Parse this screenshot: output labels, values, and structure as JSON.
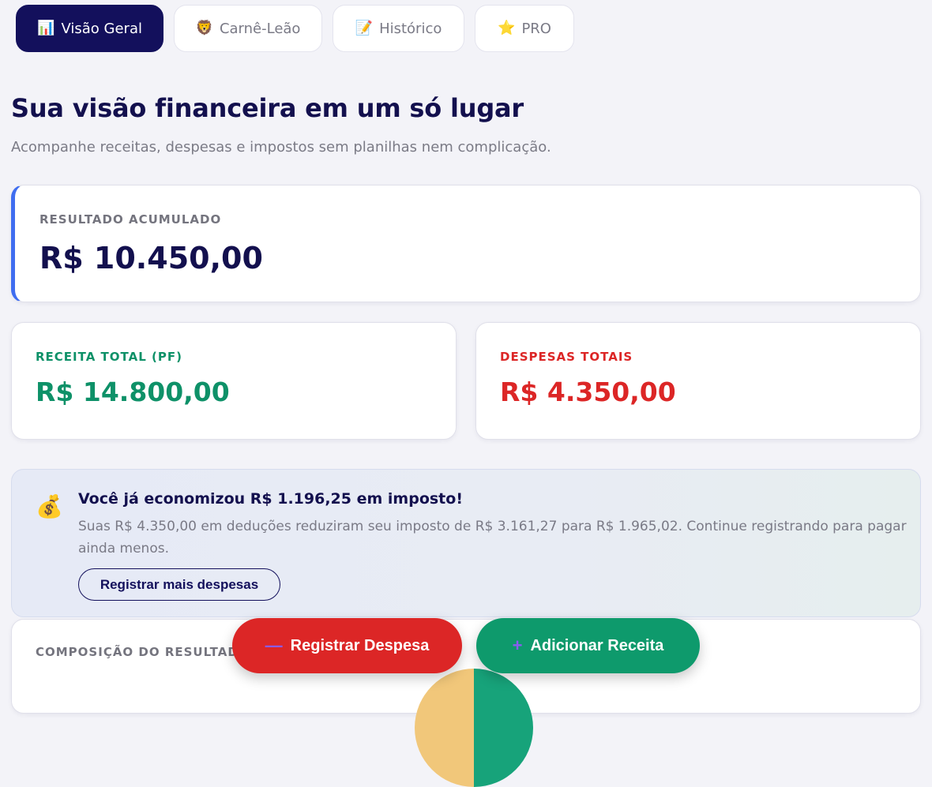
{
  "tabs": [
    {
      "icon": "bar-chart-icon",
      "glyph": "📊",
      "label": "Visão Geral",
      "active": true
    },
    {
      "icon": "lion-icon",
      "glyph": "🦁",
      "label": "Carnê-Leão",
      "active": false
    },
    {
      "icon": "memo-icon",
      "glyph": "📝",
      "label": "Histórico",
      "active": false
    },
    {
      "icon": "star-icon",
      "glyph": "⭐",
      "label": "PRO",
      "active": false
    }
  ],
  "header": {
    "title": "Sua visão financeira em um só lugar",
    "subtitle": "Acompanhe receitas, despesas e impostos sem planilhas nem complicação."
  },
  "summary": {
    "accumulated_label": "RESULTADO ACUMULADO",
    "accumulated_value": "R$ 10.450,00",
    "revenue_label": "RECEITA TOTAL (PF)",
    "revenue_value": "R$ 14.800,00",
    "expenses_label": "DESPESAS TOTAIS",
    "expenses_value": "R$ 4.350,00"
  },
  "savings": {
    "icon": "money-bag-icon",
    "glyph": "💰",
    "title": "Você já economizou R$ 1.196,25 em imposto!",
    "text": "Suas R$ 4.350,00 em deduções reduziram seu imposto de R$ 3.161,27 para R$ 1.965,02. Continue registrando para pagar ainda menos.",
    "button_label": "Registrar mais despesas"
  },
  "composition": {
    "label": "COMPOSIÇÃO DO RESULTADO"
  },
  "actions": {
    "expense_symbol": "—",
    "expense_label": "Registrar Despesa",
    "revenue_symbol": "+",
    "revenue_label": "Adicionar Receita"
  },
  "colors": {
    "primary": "#13105c",
    "accent_blue": "#3f6df0",
    "revenue_green": "#0e9168",
    "expense_red": "#dc2626",
    "background": "#f3f3f8"
  }
}
